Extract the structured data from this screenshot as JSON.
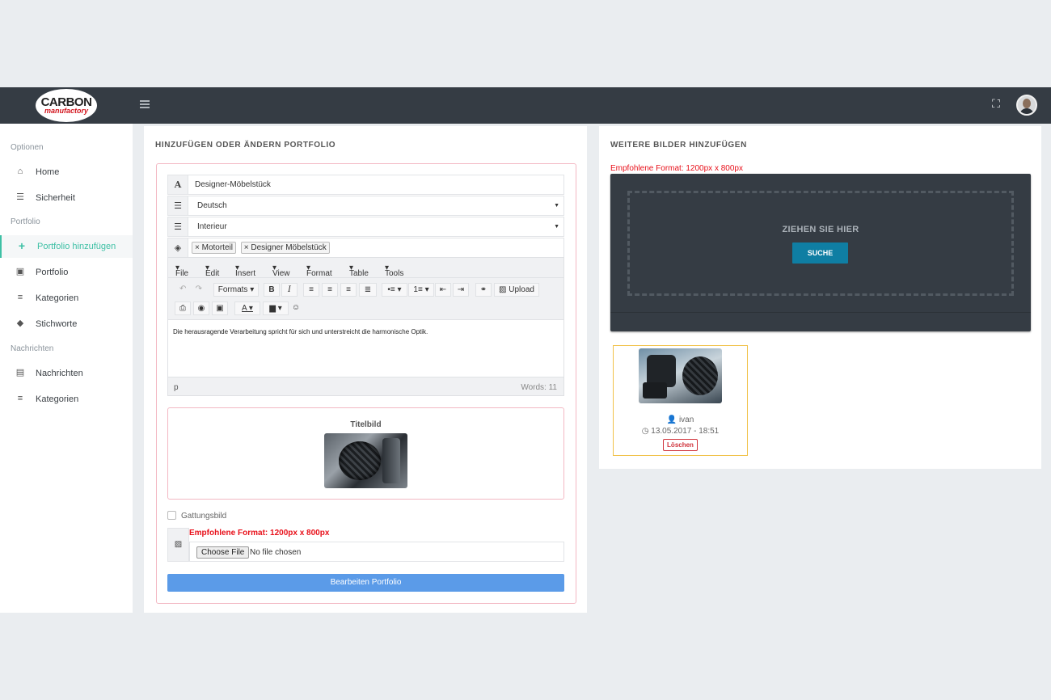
{
  "brand": {
    "logo_line1": "CARBON",
    "logo_line2": "manufactory"
  },
  "sidebar": {
    "sections": [
      "Optionen",
      "Portfolio",
      "Nachrichten"
    ],
    "items": [
      {
        "label": "Home",
        "icon": "home-icon"
      },
      {
        "label": "Sicherheit",
        "icon": "database-icon"
      },
      {
        "label": "Portfolio hinzufügen",
        "icon": "plus-icon",
        "active": true
      },
      {
        "label": "Portfolio",
        "icon": "briefcase-icon"
      },
      {
        "label": "Kategorien",
        "icon": "list-icon"
      },
      {
        "label": "Stichworte",
        "icon": "tags-icon"
      },
      {
        "label": "Nachrichten",
        "icon": "newspaper-icon"
      },
      {
        "label": "Kategorien",
        "icon": "list-icon"
      }
    ]
  },
  "form": {
    "title": "HINZUFÜGEN ODER ÄNDERN PORTFOLIO",
    "name_value": "Designer-Möbelstück",
    "language_value": "Deutsch",
    "category_value": "Interieur",
    "tags": [
      "Motorteil",
      "Designer Möbelstück"
    ],
    "editor": {
      "menu": [
        "File",
        "Edit",
        "Insert",
        "View",
        "Format",
        "Table",
        "Tools"
      ],
      "formats_label": "Formats",
      "upload_label": "Upload",
      "content": "Die herausragende Verarbeitung spricht für sich und unterstreicht die harmonische Optik.",
      "path": "p",
      "word_count": "Words: 11"
    },
    "cover_label": "Titelbild",
    "gattung_label": "Gattungsbild",
    "format_note": "Empfohlene Format: 1200px x 800px",
    "file_button": "Choose File",
    "file_status": "No file chosen",
    "submit_label": "Bearbeiten Portfolio"
  },
  "gallery": {
    "title": "WEITERE BILDER HINZUFÜGEN",
    "format_note": "Empfohlene Format: 1200px x 800px",
    "drop_text": "ZIEHEN SIE HIER",
    "search_button": "SUCHE",
    "card": {
      "user": "ivan",
      "datetime": "13.05.2017 - 18:51",
      "delete_label": "Löschen"
    }
  },
  "colors": {
    "accent": "#3ec0a5",
    "topbar": "#353c44",
    "primary_button": "#5b9be8",
    "warning": "#e8101a",
    "upload_button": "#0f7ea3"
  }
}
